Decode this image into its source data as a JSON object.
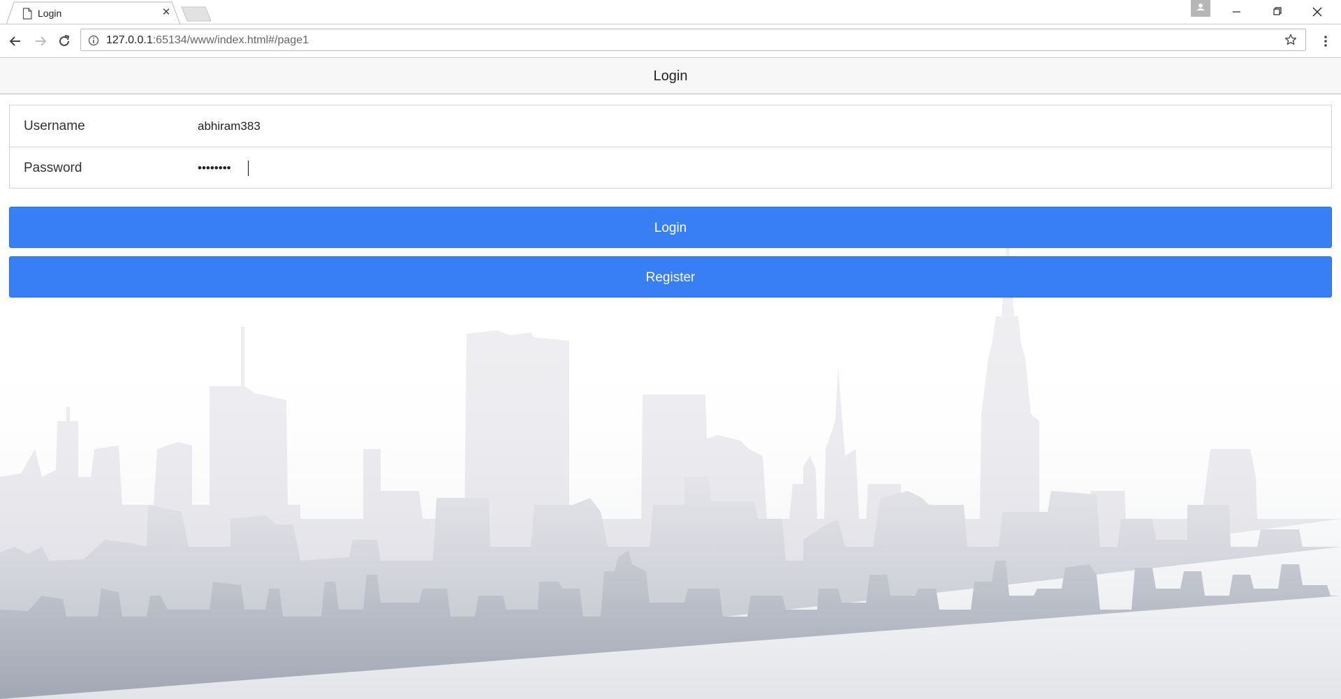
{
  "browser": {
    "tab_title": "Login",
    "url_host": "127.0.0.1",
    "url_rest": ":65134/www/index.html#/page1",
    "icons": [
      "page-icon",
      "close-icon",
      "back-icon",
      "forward-icon",
      "reload-icon",
      "info-icon",
      "star-icon",
      "menu-icon",
      "minimize-icon",
      "restore-icon",
      "window-close-icon",
      "profile-icon"
    ]
  },
  "header": {
    "title": "Login"
  },
  "form": {
    "username_label": "Username",
    "username_value": "abhiram383",
    "password_label": "Password",
    "password_value": "12345678"
  },
  "buttons": {
    "login_label": "Login",
    "register_label": "Register"
  },
  "colors": {
    "primary": "#387ef5",
    "header_bg": "#f7f7f7"
  }
}
